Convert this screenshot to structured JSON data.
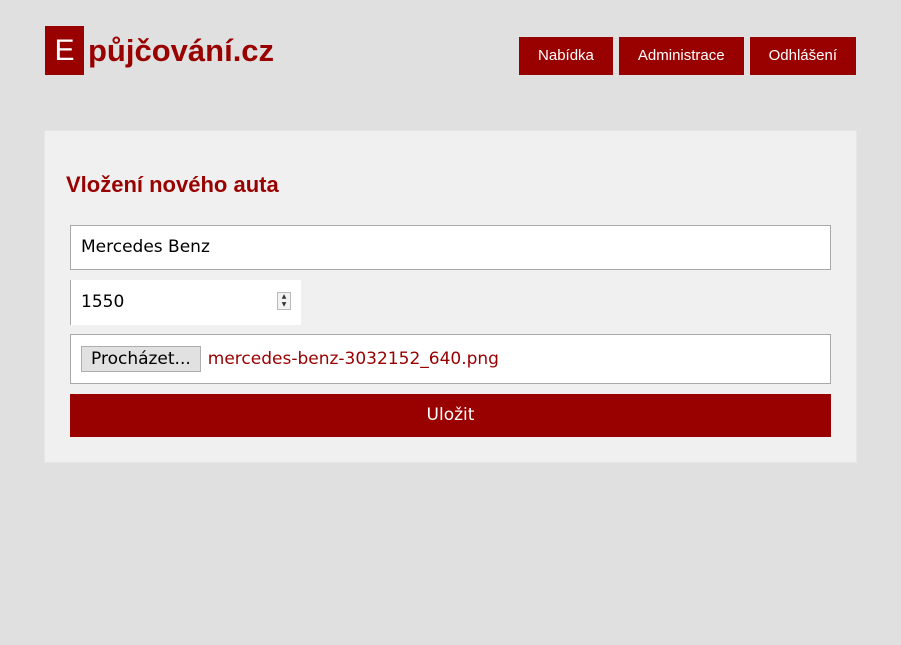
{
  "logo": {
    "letter": "E",
    "text": "půjčování.cz"
  },
  "nav": {
    "items": [
      {
        "label": "Nabídka"
      },
      {
        "label": "Administrace"
      },
      {
        "label": "Odhlášení"
      }
    ]
  },
  "form": {
    "title": "Vložení nového auta",
    "name_value": "Mercedes Benz",
    "price_value": "1550",
    "file_button_label": "Procházet...",
    "file_name": "mercedes-benz-3032152_640.png",
    "submit_label": "Uložit"
  },
  "icons": {
    "spinner": "number-spinner-icon"
  },
  "colors": {
    "accent": "#990000",
    "background": "#e0e0e0",
    "panel": "#f0f0f0"
  }
}
